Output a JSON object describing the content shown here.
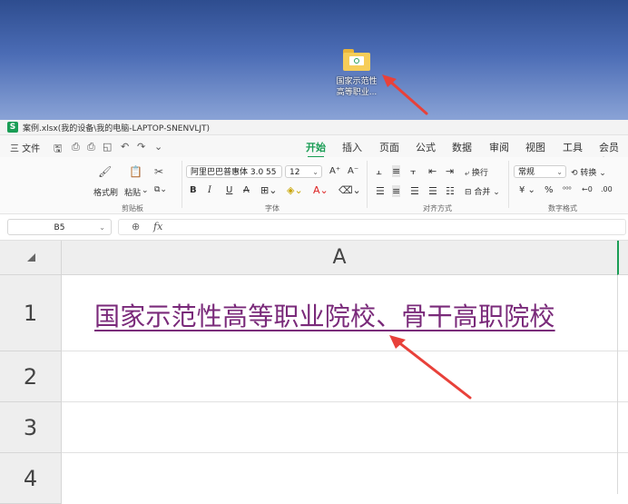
{
  "desktop": {
    "icon_label": "国家示范性高等职业..."
  },
  "window": {
    "title": "案例.xlsx(我的设备\\我的电脑-LAPTOP-SNENVLJT)",
    "app_logo": "S"
  },
  "menu": {
    "file": "三 文件",
    "tabs": [
      "开始",
      "插入",
      "页面",
      "公式",
      "数据",
      "审阅",
      "视图",
      "工具",
      "会员专"
    ],
    "active_tab": "开始"
  },
  "ribbon": {
    "format_painter": "格式刷",
    "paste": "粘贴",
    "clipboard_group": "剪贴板",
    "font_name": "阿里巴巴普惠体 3.0 55",
    "font_size": "12",
    "font_group": "字体",
    "wrap_text": "换行",
    "merge": "合并",
    "align_group": "对齐方式",
    "number_format": "常规",
    "convert": "转换",
    "number_group": "数字格式",
    "percent": "%",
    "currency": "¥"
  },
  "formula_bar": {
    "cell_ref": "B5",
    "formula": ""
  },
  "sheet": {
    "column_header": "A",
    "rows": [
      "1",
      "2",
      "3",
      "4"
    ],
    "a1_value": "国家示范性高等职业院校、骨干高职院校"
  },
  "colors": {
    "accent": "#1a9d55",
    "hyperlink": "#7a2a7a",
    "arrow": "#e8413a"
  }
}
